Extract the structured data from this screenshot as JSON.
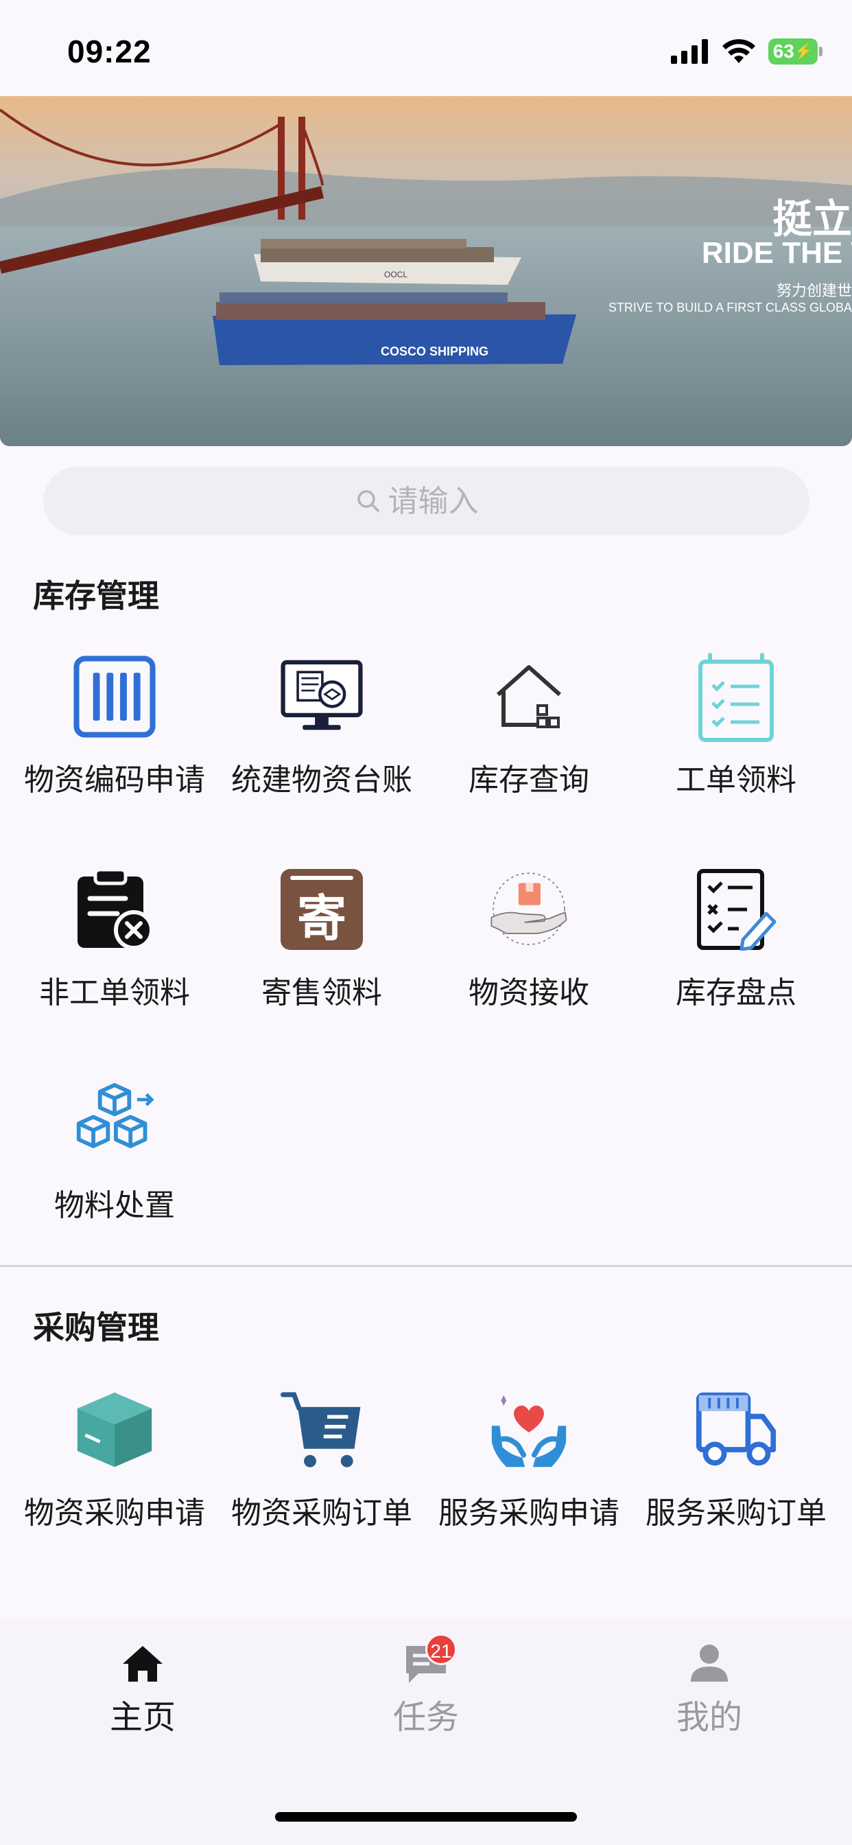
{
  "status_bar": {
    "time": "09:22",
    "battery": "63"
  },
  "banner": {
    "cn_title": "挺立",
    "en_title": "RIDE THE W",
    "cn_sub": "努力创建世",
    "en_sub": "STRIVE TO BUILD A FIRST CLASS GLOBAL",
    "ship_label_1": "OOCL",
    "ship_label_2": "COSCO SHIPPING"
  },
  "search": {
    "placeholder": "请输入"
  },
  "inventory": {
    "title": "库存管理",
    "items": [
      {
        "label": "物资编码申请",
        "icon": "barcode-icon"
      },
      {
        "label": "统建物资台账",
        "icon": "monitor-icon"
      },
      {
        "label": "库存查询",
        "icon": "warehouse-icon"
      },
      {
        "label": "工单领料",
        "icon": "clipboard-checklist-icon"
      },
      {
        "label": "非工单领料",
        "icon": "clipboard-cancel-icon"
      },
      {
        "label": "寄售领料",
        "icon": "consignment-icon",
        "glyph": "寄"
      },
      {
        "label": "物资接收",
        "icon": "receive-hand-icon"
      },
      {
        "label": "库存盘点",
        "icon": "checklist-pencil-icon"
      },
      {
        "label": "物料处置",
        "icon": "boxes-icon"
      }
    ]
  },
  "purchase": {
    "title": "采购管理",
    "items": [
      {
        "label": "物资采购申请",
        "icon": "box-icon"
      },
      {
        "label": "物资采购订单",
        "icon": "cart-icon"
      },
      {
        "label": "服务采购申请",
        "icon": "heart-hands-icon"
      },
      {
        "label": "服务采购订单",
        "icon": "truck-icon"
      }
    ]
  },
  "tabbar": {
    "home": "主页",
    "task": "任务",
    "task_badge": "21",
    "mine": "我的"
  },
  "colors": {
    "accent_blue": "#2f6fd6",
    "teal": "#46a8a0",
    "brown": "#7a5240",
    "badge_red": "#e8403a"
  }
}
